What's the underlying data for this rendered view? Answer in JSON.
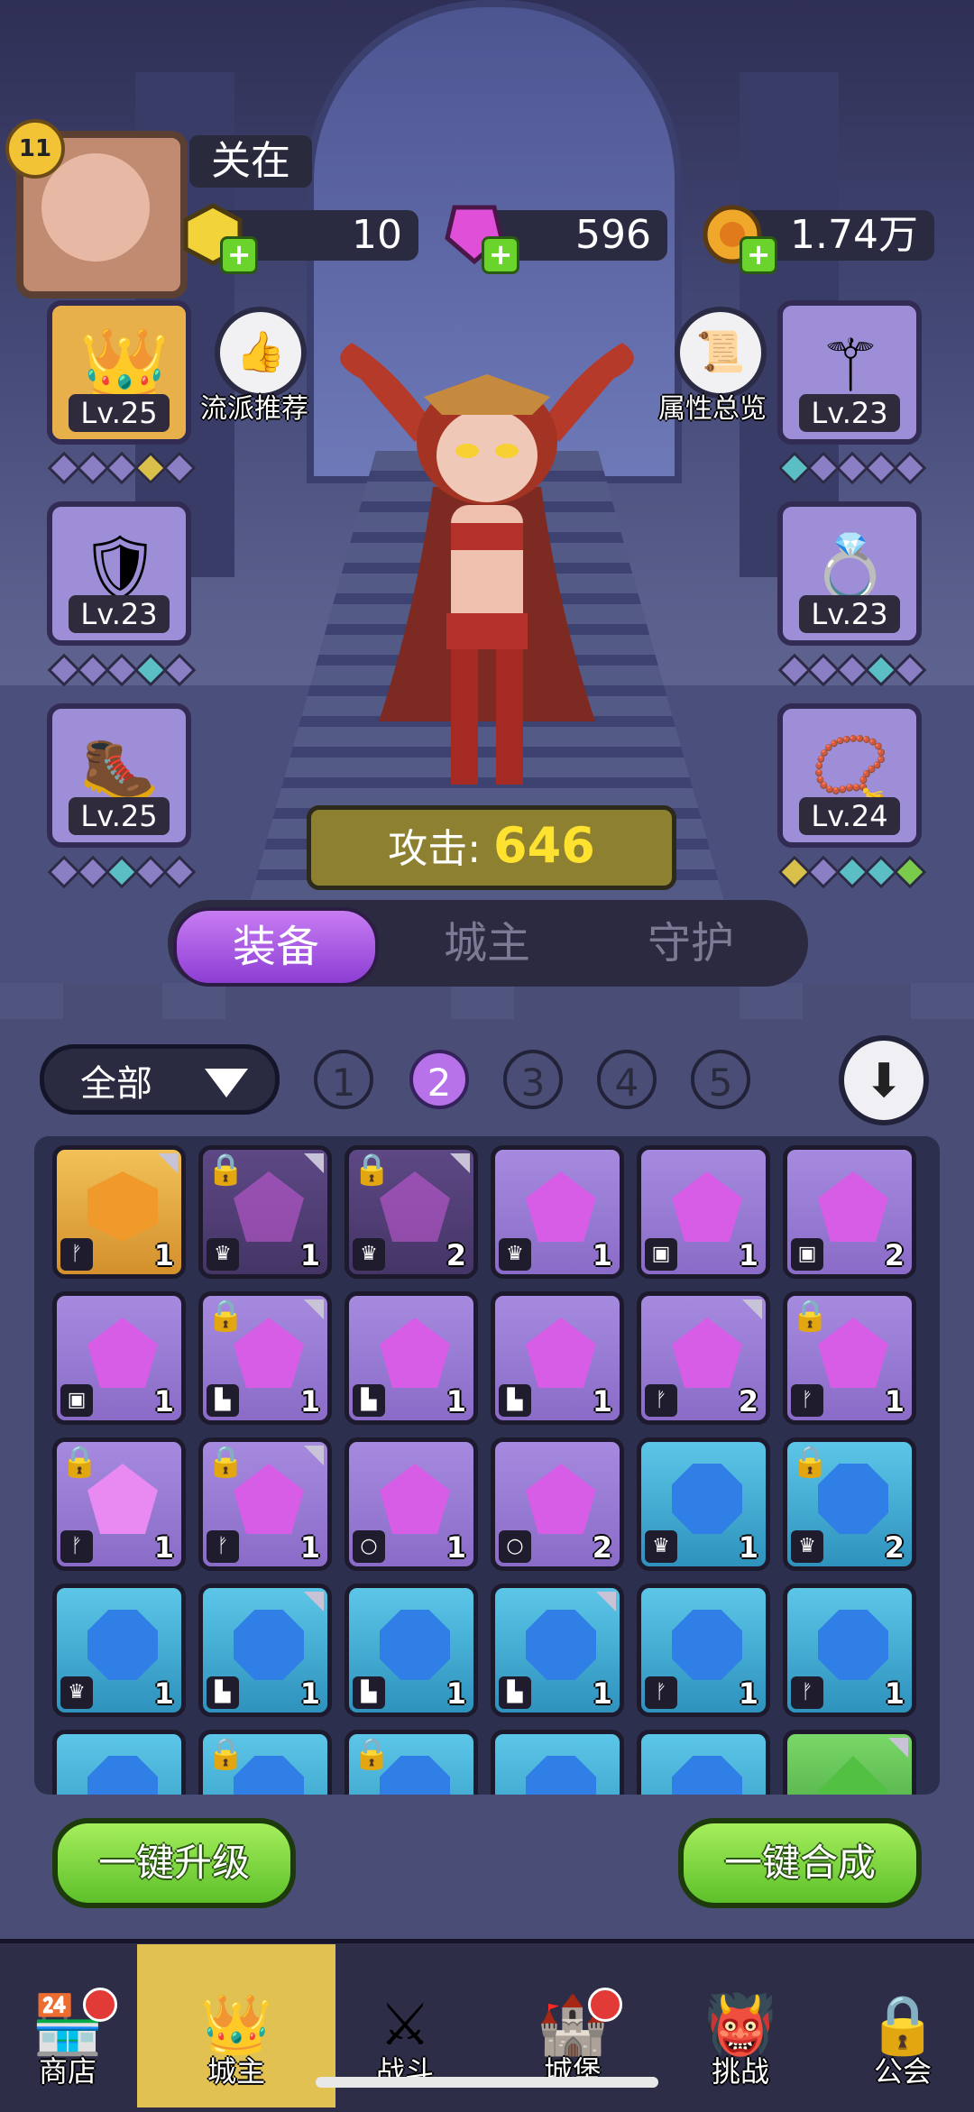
{
  "player": {
    "level": "11",
    "name": "关在"
  },
  "resources": [
    {
      "name": "gold-crystal",
      "value": "10",
      "color": "#f2d33a"
    },
    {
      "name": "pink-gem",
      "value": "596",
      "color": "#e04fd8"
    },
    {
      "name": "coin",
      "value": "1.74万",
      "color": "#f0a82a"
    }
  ],
  "left_slots": [
    {
      "icon": "crown-icon",
      "level": "Lv.25"
    },
    {
      "icon": "armor-icon",
      "level": "Lv.23"
    },
    {
      "icon": "boot-icon",
      "level": "Lv.25"
    }
  ],
  "right_slots": [
    {
      "icon": "staff-icon",
      "level": "Lv.23"
    },
    {
      "icon": "ring-icon",
      "level": "Lv.23"
    },
    {
      "icon": "necklace-icon",
      "level": "Lv.24"
    }
  ],
  "buttons": {
    "recommend": "流派推荐",
    "attributes": "属性总览"
  },
  "attack": {
    "label": "攻击:",
    "value": "646"
  },
  "tabs": [
    "装备",
    "城主",
    "守护"
  ],
  "filter": {
    "label": "全部"
  },
  "page_tabs": [
    "1",
    "2",
    "3",
    "4",
    "5"
  ],
  "grid_items": [
    {
      "counts": [
        "1",
        "1",
        "2",
        "1",
        "1",
        "2"
      ]
    },
    {
      "counts": [
        "1",
        "1",
        "1",
        "1",
        "2",
        "1"
      ]
    },
    {
      "counts": [
        "1",
        "1",
        "1",
        "2",
        "1",
        "2"
      ]
    },
    {
      "counts": [
        "1",
        "1",
        "1",
        "1",
        "1",
        "1"
      ]
    }
  ],
  "actions": {
    "upgrade": "一键升级",
    "synthesize": "一键合成"
  },
  "nav": [
    "商店",
    "城主",
    "战斗",
    "城堡",
    "挑战",
    "公会"
  ]
}
